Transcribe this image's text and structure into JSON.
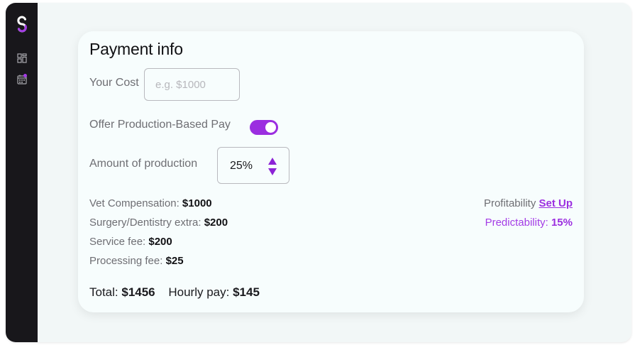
{
  "sidebar": {
    "items": [
      {
        "icon": "dashboard-icon"
      },
      {
        "icon": "calendar-icon",
        "has_notification": true
      }
    ]
  },
  "payment": {
    "title": "Payment info",
    "cost_label": "Your Cost",
    "cost_value": "",
    "cost_placeholder": "e.g. $1000",
    "offer_label": "Offer Production-Based Pay",
    "offer_enabled": true,
    "amount_label": "Amount of production",
    "amount_value": "25%"
  },
  "breakdown": {
    "vet_label": "Vet Compensation: ",
    "vet_value": "$1000",
    "surgery_label": "Surgery/Dentistry extra: ",
    "surgery_value": "$200",
    "service_label": "Service fee: ",
    "service_value": "$200",
    "processing_label": "Processing fee: ",
    "processing_value": "$25"
  },
  "metrics": {
    "profitability_label": "Profitability ",
    "profitability_link": "Set Up",
    "predictability_label": "Predictability: ",
    "predictability_value": "15%"
  },
  "totals": {
    "total_label": "Total: ",
    "total_value": "$1456",
    "hourly_label": "Hourly pay: ",
    "hourly_value": "$145"
  },
  "colors": {
    "accent": "#9b2ee0",
    "sidebar_bg": "#18171b",
    "page_bg": "#f2f7f7",
    "card_bg": "#f7fdfd"
  }
}
